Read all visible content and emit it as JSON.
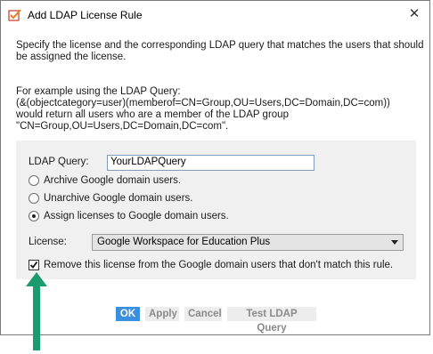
{
  "window": {
    "title": "Add LDAP License Rule",
    "close_glyph": "✕"
  },
  "description": {
    "line1": "Specify the license and the corresponding LDAP query that matches the users that should be assigned the license.",
    "example_intro": "For example using the LDAP Query:",
    "example_query": "(&(objectcategory=user)(memberof=CN=Group,OU=Users,DC=Domain,DC=com))",
    "example_result": "would return all users who are a member of the LDAP group",
    "example_group": "\"CN=Group,OU=Users,DC=Domain,DC=com\"."
  },
  "form": {
    "ldap_query_label": "LDAP Query:",
    "ldap_query_value": "YourLDAPQuery",
    "radio_options": [
      {
        "label": "Archive Google domain users.",
        "selected": false
      },
      {
        "label": "Unarchive Google domain users.",
        "selected": false
      },
      {
        "label": "Assign licenses to Google domain users.",
        "selected": true
      }
    ],
    "license_label": "License:",
    "license_value": "Google Workspace for Education Plus",
    "remove_checkbox_label": "Remove this license from the Google domain users that don't match this rule.",
    "remove_checkbox_checked": true
  },
  "buttons": {
    "ok": "OK",
    "apply": "Apply",
    "cancel": "Cancel",
    "test": "Test LDAP Query"
  },
  "colors": {
    "annotation_arrow": "#1a9c6e",
    "primary_button": "#3b8fe0",
    "panel_bg": "#f0f0f0"
  }
}
